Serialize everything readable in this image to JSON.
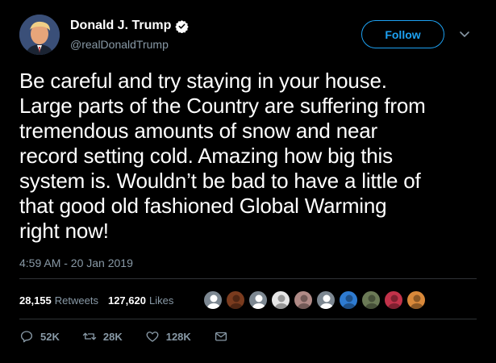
{
  "user": {
    "display_name": "Donald J. Trump",
    "handle": "@realDonaldTrump",
    "verified": true
  },
  "follow_button": {
    "label": "Follow"
  },
  "tweet": {
    "text": "Be careful and try staying in your house.\nLarge parts of the Country are suffering from\ntremendous amounts of snow and near\nrecord setting cold. Amazing how big this\nsystem is. Wouldn’t be bad to have a little of\nthat good old fashioned Global Warming\nright now!",
    "timestamp": "4:59 AM - 20 Jan 2019"
  },
  "stats": {
    "retweets": {
      "count": "28,155",
      "label": "Retweets"
    },
    "likes": {
      "count": "127,620",
      "label": "Likes"
    }
  },
  "likers": [
    {
      "icon": "default-avatar-icon",
      "color": "#7c8791"
    },
    {
      "icon": "user-avatar-icon",
      "color": "#7a3b1e"
    },
    {
      "icon": "default-avatar-icon",
      "color": "#7c8791"
    },
    {
      "icon": "user-avatar-icon",
      "color": "#e6e6e6"
    },
    {
      "icon": "user-avatar-icon",
      "color": "#b08a86"
    },
    {
      "icon": "default-avatar-icon",
      "color": "#7c8791"
    },
    {
      "icon": "user-avatar-icon",
      "color": "#2e7bd1"
    },
    {
      "icon": "user-avatar-icon",
      "color": "#6b7a56"
    },
    {
      "icon": "user-avatar-icon",
      "color": "#c2324a"
    },
    {
      "icon": "user-avatar-icon",
      "color": "#d9893a"
    }
  ],
  "actions": {
    "reply": {
      "icon": "reply-icon",
      "count": "52K"
    },
    "retweet": {
      "icon": "retweet-icon",
      "count": "28K"
    },
    "like": {
      "icon": "heart-icon",
      "count": "128K"
    },
    "message": {
      "icon": "envelope-icon"
    }
  },
  "colors": {
    "background": "#000000",
    "accent": "#1da1f2",
    "muted": "#8899a6",
    "text": "#ffffff"
  }
}
